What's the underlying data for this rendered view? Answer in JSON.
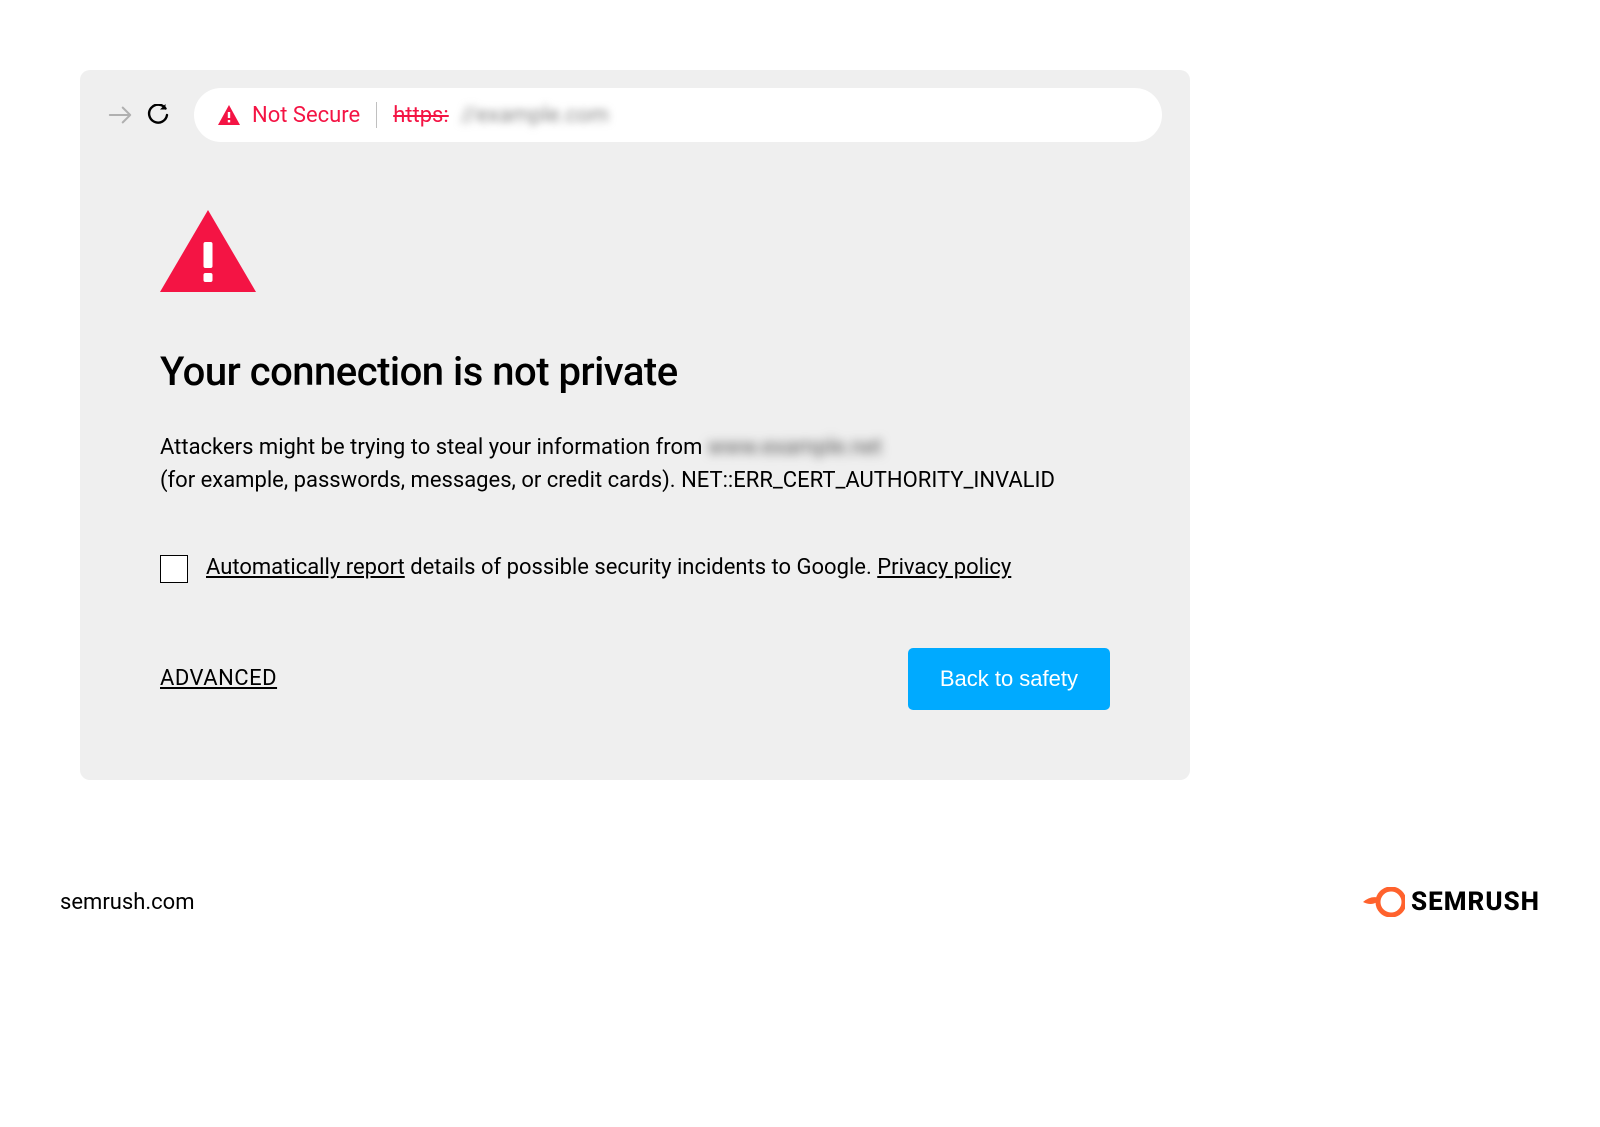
{
  "addressBar": {
    "notSecureLabel": "Not Secure",
    "httpsLabel": "https:"
  },
  "page": {
    "title": "Your connection is not private",
    "messageLine1Prefix": "Attackers might be trying to steal your information from ",
    "messageLine2Prefix": "(for example, passwords, messages, or credit cards). ",
    "errorCode": "NET::ERR_CERT_AUTHORITY_INVALID",
    "checkbox": {
      "linkText1": "Automatically report",
      "midText": " details of possible security incidents to Google. ",
      "linkText2": "Privacy policy"
    },
    "advancedLabel": "ADVANCED",
    "backButtonLabel": "Back to safety"
  },
  "footer": {
    "domain": "semrush.com",
    "brand": "SEMRUSH"
  },
  "colors": {
    "danger": "#f41444",
    "primary": "#00aaff",
    "brandOrange": "#ff622d"
  }
}
